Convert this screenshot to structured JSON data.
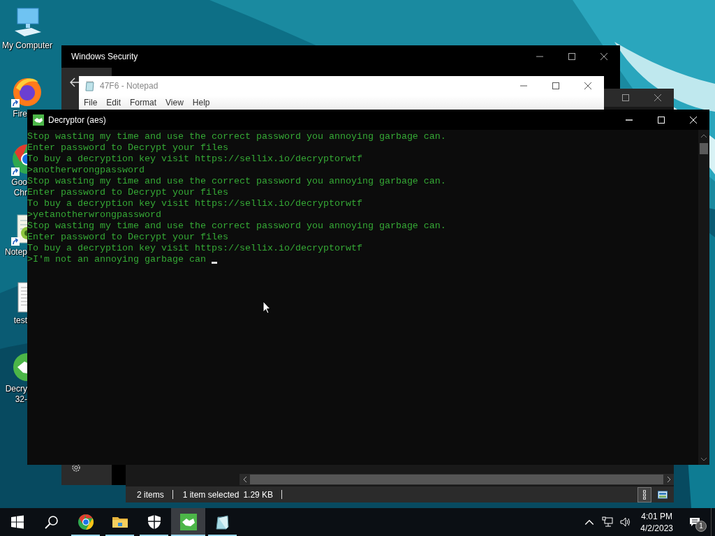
{
  "desktop": {
    "icons": [
      {
        "kind": "computer",
        "lines": [
          "My Computer"
        ],
        "shortcut": false
      },
      {
        "kind": "firefox",
        "lines": [
          "Fire"
        ],
        "shortcut": true
      },
      {
        "kind": "chrome",
        "lines": [
          "Goo",
          "Chr"
        ],
        "shortcut": true
      },
      {
        "kind": "notepad",
        "lines": [
          "Notep"
        ],
        "shortcut": true
      },
      {
        "kind": "document",
        "lines": [
          "test"
        ],
        "shortcut": false
      },
      {
        "kind": "decryptor",
        "lines": [
          "Decry",
          "32-"
        ],
        "shortcut": false
      }
    ]
  },
  "security_window": {
    "title": "Windows Security"
  },
  "explorer_window": {
    "status_bar": {
      "item_count": "2 items",
      "selection": "1 item selected",
      "size": "1.29 KB"
    },
    "views": [
      {
        "kind": "details",
        "selected": true
      },
      {
        "kind": "thumbnails",
        "selected": false
      }
    ]
  },
  "notepad_window": {
    "title": "47F6 - Notepad",
    "menu": [
      "File",
      "Edit",
      "Format",
      "View",
      "Help"
    ]
  },
  "console_window": {
    "title": "Decryptor (aes)",
    "lines": [
      "Stop wasting my time and use the correct password you annoying garbage can.",
      "Enter password to Decrypt your files",
      "To buy a decryption key visit https://sellix.io/decryptorwtf",
      ">anotherwrongpassword",
      "Stop wasting my time and use the correct password you annoying garbage can.",
      "Enter password to Decrypt your files",
      "To buy a decryption key visit https://sellix.io/decryptorwtf",
      ">yetanotherwrongpassword",
      "Stop wasting my time and use the correct password you annoying garbage can.",
      "Enter password to Decrypt your files",
      "To buy a decryption key visit https://sellix.io/decryptorwtf",
      ">I'm not an annoying garbage can "
    ]
  },
  "taskbar": {
    "items": [
      {
        "kind": "start",
        "selected": false,
        "running": false
      },
      {
        "kind": "search",
        "selected": false,
        "running": false
      },
      {
        "kind": "chrome",
        "selected": false,
        "running": true
      },
      {
        "kind": "folder",
        "selected": false,
        "running": true
      },
      {
        "kind": "shield",
        "selected": false,
        "running": true
      },
      {
        "kind": "decryptor",
        "selected": true,
        "running": true
      },
      {
        "kind": "notepad",
        "selected": false,
        "running": true
      }
    ],
    "tray": {
      "time": "4:01 PM",
      "date": "4/2/2023",
      "notifications": "1"
    }
  }
}
